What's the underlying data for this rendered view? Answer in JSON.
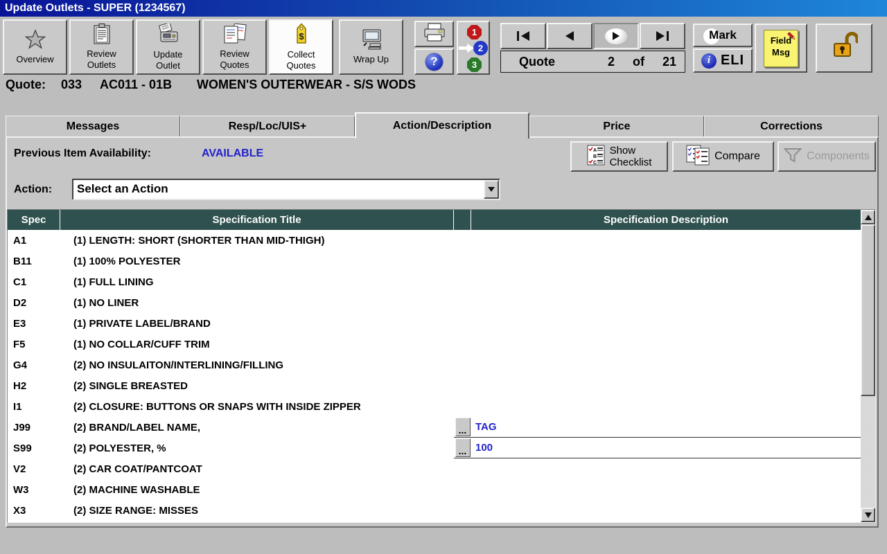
{
  "colors": {
    "titlebar_gradient_left": "#0a1398",
    "titlebar_gradient_right": "#1e86d8",
    "table_header_bg": "#2f5150",
    "value_blue": "#2222cc",
    "window_bg": "#bdbdbd",
    "active_toolbar_button_bg": "#fcfcfc"
  },
  "icons": {
    "overview": "star-icon",
    "review_outlets": "clipboard-icon",
    "update_outlet": "register-icon",
    "review_quotes": "notes-icon",
    "collect_quotes": "price-tag-icon",
    "wrap_up": "computer-icon",
    "print": "printer-icon",
    "help": "question-icon",
    "steps": "steps-123-icon",
    "mark": "circle-icon",
    "eli": "info-icon",
    "field_msg": "sticky-note-pencil-icon",
    "lock": "unlock-icon",
    "show_checklist": "checklist-icon",
    "compare": "compare-checklists-icon",
    "components": "funnel-icon"
  },
  "title_bar": {
    "title": "Update Outlets -  SUPER (1234567)"
  },
  "toolbar": {
    "buttons": [
      {
        "label": "Overview",
        "active": false
      },
      {
        "label": "Review\nOutlets",
        "active": false
      },
      {
        "label": "Update\nOutlet",
        "active": false
      },
      {
        "label": "Review\nQuotes",
        "active": false
      },
      {
        "label": "Collect\nQuotes",
        "active": true
      },
      {
        "label": "Wrap Up",
        "active": false
      }
    ],
    "help_glyph": "?",
    "dollar_glyph": "$",
    "steps": {
      "one": "1",
      "two": "2",
      "three": "3"
    },
    "record_nav": {
      "label": "Quote",
      "current": "2",
      "of": "of",
      "total": "21"
    },
    "mark_label": "Mark",
    "eli": {
      "info_glyph": "i",
      "label": "ELI"
    },
    "field_msg": {
      "line1": "Field",
      "line2": "Msg"
    }
  },
  "quote_header": {
    "label": "Quote:",
    "number": "033",
    "code": "AC011 - 01B",
    "description": "WOMEN'S OUTERWEAR - S/S WODS"
  },
  "tabs": [
    {
      "label": "Messages",
      "active": false
    },
    {
      "label": "Resp/Loc/UIS+",
      "active": false
    },
    {
      "label": "Action/Description",
      "active": true
    },
    {
      "label": "Price",
      "active": false
    },
    {
      "label": "Corrections",
      "active": false
    }
  ],
  "panel": {
    "availability_label": "Previous Item Availability:",
    "availability_value": "AVAILABLE",
    "show_checklist_label": "Show\nChecklist",
    "compare_label": "Compare",
    "components_label": "Components",
    "components_enabled": false,
    "action_label": "Action:",
    "action_selected": "Select an Action"
  },
  "spec_table": {
    "headers": {
      "spec": "Spec",
      "title": "Specification Title",
      "description": "Specification Description"
    },
    "ellipsis": "...",
    "rows": [
      {
        "spec": "A1",
        "title": "(1) LENGTH: SHORT (SHORTER THAN MID-THIGH)",
        "desc": "",
        "editor": false
      },
      {
        "spec": "B11",
        "title": "(1) 100% POLYESTER",
        "desc": "",
        "editor": false
      },
      {
        "spec": "C1",
        "title": "(1) FULL LINING",
        "desc": "",
        "editor": false
      },
      {
        "spec": "D2",
        "title": "(1) NO LINER",
        "desc": "",
        "editor": false
      },
      {
        "spec": "E3",
        "title": "(1) PRIVATE LABEL/BRAND",
        "desc": "",
        "editor": false
      },
      {
        "spec": "F5",
        "title": "(1) NO COLLAR/CUFF TRIM",
        "desc": "",
        "editor": false
      },
      {
        "spec": "G4",
        "title": "(2) NO INSULAITON/INTERLINING/FILLING",
        "desc": "",
        "editor": false
      },
      {
        "spec": "H2",
        "title": "(2) SINGLE BREASTED",
        "desc": "",
        "editor": false
      },
      {
        "spec": "I1",
        "title": "(2) CLOSURE: BUTTONS OR SNAPS WITH INSIDE ZIPPER",
        "desc": "",
        "editor": false
      },
      {
        "spec": "J99",
        "title": "(2) BRAND/LABEL NAME,",
        "desc": "TAG",
        "editor": true
      },
      {
        "spec": "S99",
        "title": "(2) POLYESTER, %",
        "desc": "100",
        "editor": true
      },
      {
        "spec": "V2",
        "title": "(2) CAR COAT/PANTCOAT",
        "desc": "",
        "editor": false
      },
      {
        "spec": "W3",
        "title": "(2) MACHINE WASHABLE",
        "desc": "",
        "editor": false
      },
      {
        "spec": "X3",
        "title": "(2) SIZE RANGE: MISSES",
        "desc": "",
        "editor": false
      }
    ]
  }
}
